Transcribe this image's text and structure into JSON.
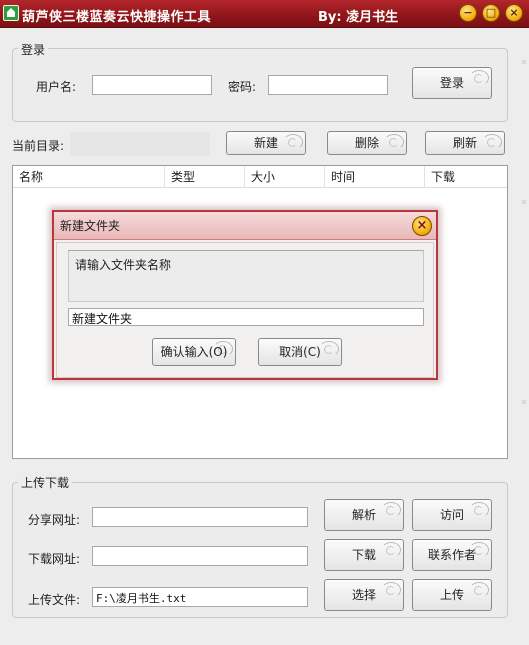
{
  "window": {
    "title": "葫芦侠三楼蓝奏云快捷操作工具",
    "author": "By: 凌月书生",
    "controls": {
      "minimize": "−",
      "maximize": "□",
      "close": "×"
    }
  },
  "login": {
    "legend": "登录",
    "username_label": "用户名:",
    "username_value": "",
    "password_label": "密码:",
    "password_value": "",
    "login_button": "登录"
  },
  "directory": {
    "label": "当前目录:",
    "new_button": "新建",
    "delete_button": "删除",
    "refresh_button": "刷新"
  },
  "file_list": {
    "columns": [
      "名称",
      "类型",
      "大小",
      "时间",
      "下载"
    ],
    "rows": []
  },
  "dialog": {
    "title": "新建文件夹",
    "close_icon": "×",
    "prompt": "请输入文件夹名称",
    "input_value": "新建文件夹",
    "confirm_button": "确认输入(O)",
    "cancel_button": "取消(C)"
  },
  "transfer": {
    "legend": "上传下载",
    "share_url_label": "分享网址:",
    "share_url_value": "",
    "download_url_label": "下载网址:",
    "download_url_value": "",
    "upload_file_label": "上传文件:",
    "upload_file_value": "F:\\凌月书生.txt",
    "parse_button": "解析",
    "visit_button": "访问",
    "download_button": "下载",
    "contact_button": "联系作者",
    "select_button": "选择",
    "upload_button": "上传"
  },
  "colors": {
    "titlebar": "#8e1519",
    "dialog_border": "#b23a3f",
    "dialog_title_bg": "#f0c9ca",
    "window_bg": "#ededed"
  }
}
